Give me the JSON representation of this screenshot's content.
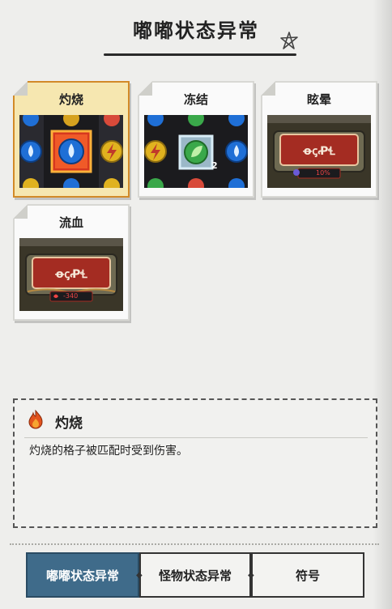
{
  "header": {
    "title": "嘟嘟状态异常",
    "icon": "star-doodle-icon"
  },
  "cards": [
    {
      "label": "灼烧",
      "selected": true
    },
    {
      "label": "冻结",
      "selected": false,
      "count": "2"
    },
    {
      "label": "眩晕",
      "selected": false,
      "percent": "10%"
    },
    {
      "label": "流血",
      "selected": false,
      "damage": "-340"
    }
  ],
  "detail": {
    "icon": "fire-icon",
    "title": "灼烧",
    "text": "灼烧的格子被匹配时受到伤害。"
  },
  "tabs": [
    {
      "label": "嘟嘟状态异常",
      "active": true
    },
    {
      "label": "怪物状态异常",
      "active": false
    },
    {
      "label": "符号",
      "active": false
    }
  ],
  "colors": {
    "accent": "#3f6b8a",
    "selected_card": "#f6e7b0",
    "selected_border": "#d28a28"
  }
}
